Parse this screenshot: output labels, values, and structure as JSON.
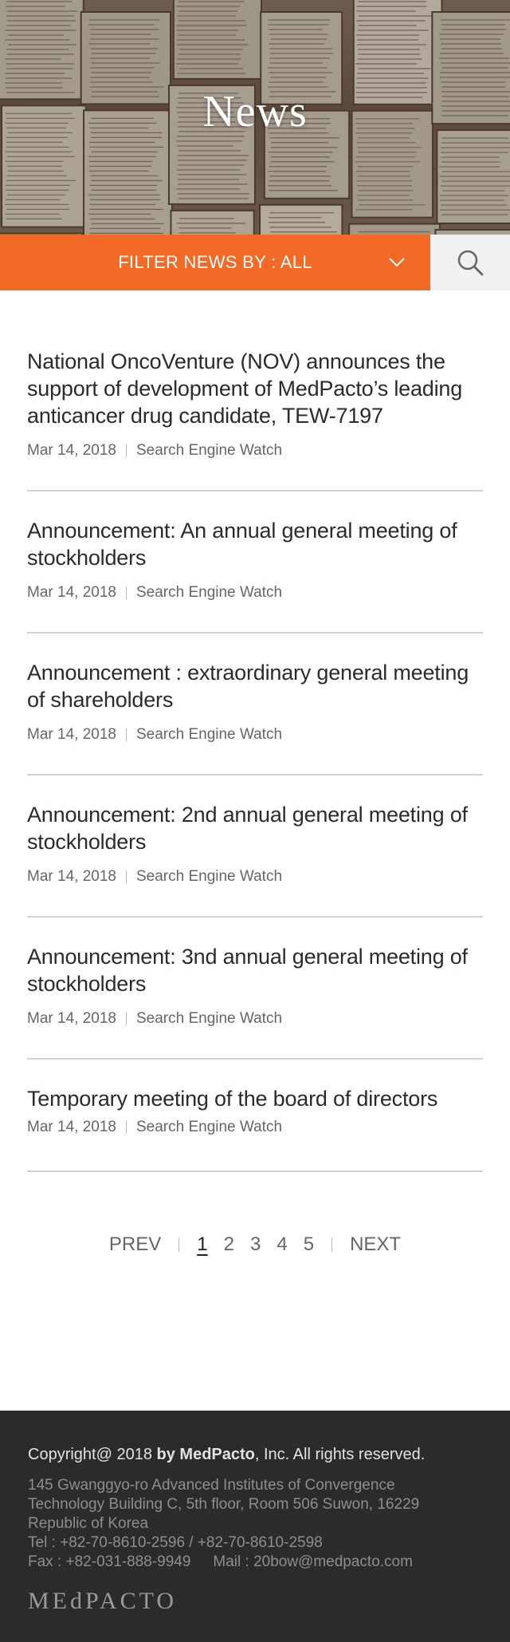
{
  "hero": {
    "title": "News"
  },
  "filter": {
    "label": "FILTER NEWS BY : ALL",
    "accent": "#f26a25"
  },
  "search": {
    "icon": "search-icon"
  },
  "news": [
    {
      "title": "National OncoVenture (NOV) announces the support of development of MedPacto’s leading anticancer drug candidate, TEW-7197",
      "date": "Mar 14, 2018",
      "source": "Search Engine Watch"
    },
    {
      "title": "Announcement: An annual general meeting of stockholders",
      "date": "Mar 14, 2018",
      "source": "Search Engine Watch"
    },
    {
      "title": "Announcement : extraordinary general meeting of shareholders",
      "date": "Mar 14, 2018",
      "source": "Search Engine Watch"
    },
    {
      "title": "Announcement: 2nd annual general meeting of stockholders",
      "date": "Mar 14, 2018",
      "source": "Search Engine Watch"
    },
    {
      "title": "Announcement: 3nd annual general meeting of stockholders",
      "date": "Mar 14, 2018",
      "source": "Search Engine Watch"
    },
    {
      "title": "Temporary meeting of the board of directors",
      "date": "Mar 14, 2018",
      "source": "Search Engine Watch"
    }
  ],
  "pagination": {
    "prev": "PREV",
    "pages": [
      "1",
      "2",
      "3",
      "4",
      "5"
    ],
    "current": "1",
    "next": "NEXT"
  },
  "footer": {
    "copyright_prefix": "Copyright@ 2018 ",
    "copyright_brand": "by MedPacto",
    "copyright_suffix": ", Inc. All rights reserved.",
    "address_line1": "145 Gwanggyo-ro Advanced Institutes of Convergence",
    "address_line2": "Technology Building C, 5th floor, Room 506 Suwon, 16229",
    "address_line3": "Republic of Korea",
    "tel": "Tel : +82-70-8610-2596 / +82-70-8610-2598",
    "fax": "Fax : +82-031-888-9949",
    "mail": "Mail : 20bow@medpacto.com",
    "logo": "MEdPACTO"
  }
}
